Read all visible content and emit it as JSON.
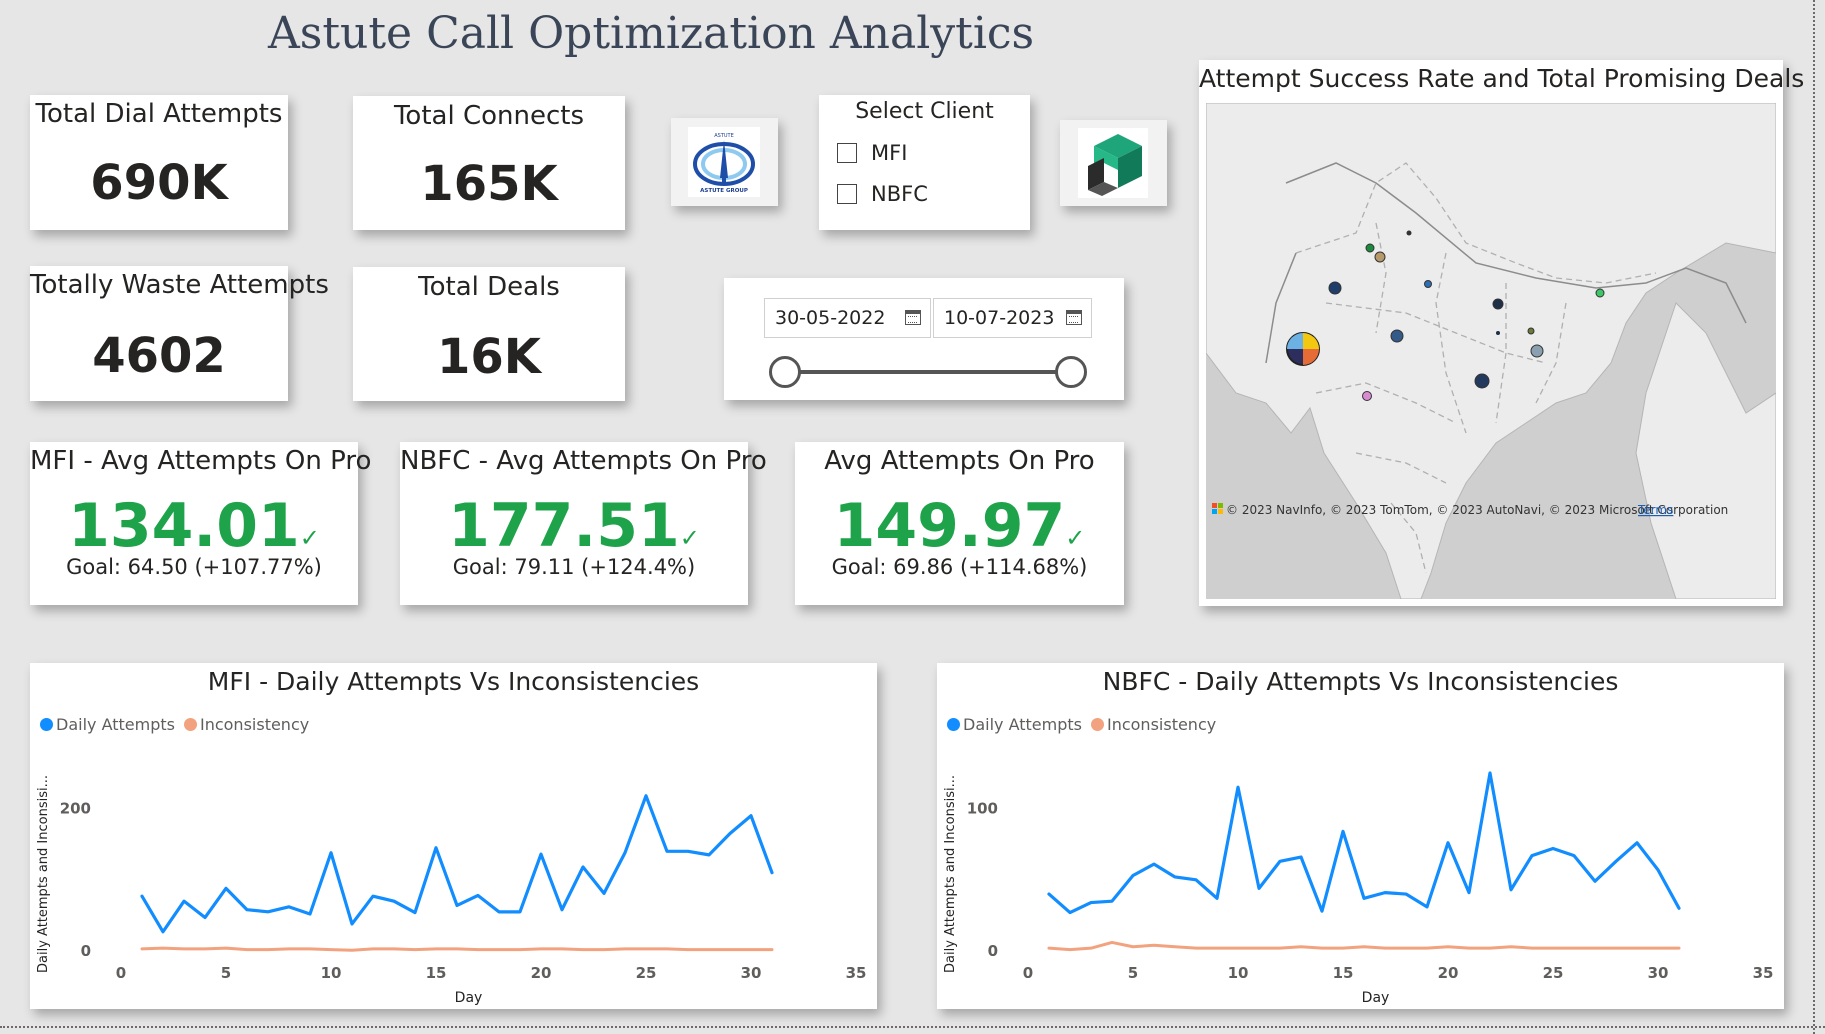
{
  "title": "Astute Call Optimization Analytics",
  "cards": {
    "total_dial_attempts": {
      "label": "Total Dial Attempts",
      "value": "690K"
    },
    "total_connects": {
      "label": "Total Connects",
      "value": "165K"
    },
    "totally_waste_attempts": {
      "label": "Totally Waste Attempts",
      "value": "4602"
    },
    "total_deals": {
      "label": "Total Deals",
      "value": "16K"
    }
  },
  "kpis": {
    "mfi": {
      "label": "MFI - Avg Attempts On Pro",
      "value": "134.01",
      "goal": "Goal: 64.50 (+107.77%)"
    },
    "nbfc": {
      "label": "NBFC - Avg Attempts On Pro",
      "value": "177.51",
      "goal": "Goal: 79.11 (+124.4%)"
    },
    "overall": {
      "label": "Avg Attempts On Pro",
      "value": "149.97",
      "goal": "Goal: 69.86 (+114.68%)"
    }
  },
  "client_slicer": {
    "label": "Select Client",
    "options": [
      "MFI",
      "NBFC"
    ]
  },
  "date_slicer": {
    "start": "30-05-2022",
    "end": "10-07-2023"
  },
  "logos": {
    "astute_top_text": "ASTUTE",
    "astute_bottom_text": "ASTUTE GROUP"
  },
  "map": {
    "title": "Attempt Success Rate and Total Promising Deals",
    "attribution": "© 2023 NavInfo, © 2023 TomTom, © 2023 AutoNavi, © 2023 Microsoft Corporation",
    "terms_link": "Terms"
  },
  "colors": {
    "daily_attempts": "#118dff",
    "inconsistency": "#f2a27e",
    "kpi_green": "#1ea34b",
    "title": "#3a4557"
  },
  "chart_data": [
    {
      "type": "line",
      "title": "MFI - Daily Attempts Vs Inconsistencies",
      "xlabel": "Day",
      "ylabel": "Daily Attempts and Inconsisi...",
      "legend": "top-left",
      "grid": false,
      "xlim": [
        0,
        35
      ],
      "ylim": [
        0,
        250
      ],
      "x_ticks": [
        0,
        5,
        10,
        15,
        20,
        25,
        30,
        35
      ],
      "y_ticks": [
        0,
        200
      ],
      "x": [
        1,
        2,
        3,
        4,
        5,
        6,
        7,
        8,
        9,
        10,
        11,
        12,
        13,
        14,
        15,
        16,
        17,
        18,
        19,
        20,
        21,
        22,
        23,
        24,
        25,
        26,
        27,
        28,
        29,
        30,
        31
      ],
      "series": [
        {
          "name": "Daily Attempts",
          "color": "#118dff",
          "values": [
            77,
            27,
            70,
            47,
            88,
            58,
            55,
            62,
            52,
            138,
            38,
            77,
            70,
            54,
            145,
            64,
            78,
            55,
            55,
            136,
            58,
            118,
            81,
            138,
            218,
            140,
            140,
            135,
            165,
            190,
            110
          ]
        },
        {
          "name": "Inconsistency",
          "color": "#f2a27e",
          "values": [
            3,
            4,
            3,
            3,
            4,
            2,
            2,
            3,
            3,
            2,
            1,
            3,
            3,
            2,
            3,
            3,
            2,
            2,
            2,
            3,
            3,
            2,
            2,
            3,
            3,
            3,
            2,
            2,
            2,
            2,
            2
          ]
        }
      ]
    },
    {
      "type": "line",
      "title": "NBFC - Daily Attempts Vs Inconsistencies",
      "xlabel": "Day",
      "ylabel": "Daily Attempts and Inconsisi...",
      "legend": "top-left",
      "grid": false,
      "xlim": [
        0,
        35
      ],
      "ylim": [
        0,
        125
      ],
      "x_ticks": [
        0,
        5,
        10,
        15,
        20,
        25,
        30,
        35
      ],
      "y_ticks": [
        0,
        100
      ],
      "x": [
        1,
        2,
        3,
        4,
        5,
        6,
        7,
        8,
        9,
        10,
        11,
        12,
        13,
        14,
        15,
        16,
        17,
        18,
        19,
        20,
        21,
        22,
        23,
        24,
        25,
        26,
        27,
        28,
        29,
        30,
        31
      ],
      "series": [
        {
          "name": "Daily Attempts",
          "color": "#118dff",
          "values": [
            40,
            27,
            34,
            35,
            53,
            61,
            52,
            50,
            37,
            115,
            44,
            63,
            66,
            28,
            84,
            37,
            41,
            40,
            31,
            76,
            41,
            125,
            43,
            67,
            72,
            67,
            49,
            63,
            76,
            57,
            30
          ]
        },
        {
          "name": "Inconsistency",
          "color": "#f2a27e",
          "values": [
            2,
            1,
            2,
            6,
            3,
            4,
            3,
            2,
            2,
            2,
            2,
            2,
            3,
            2,
            2,
            3,
            2,
            2,
            2,
            3,
            2,
            2,
            3,
            2,
            2,
            2,
            2,
            2,
            2,
            2,
            2
          ]
        }
      ]
    }
  ]
}
